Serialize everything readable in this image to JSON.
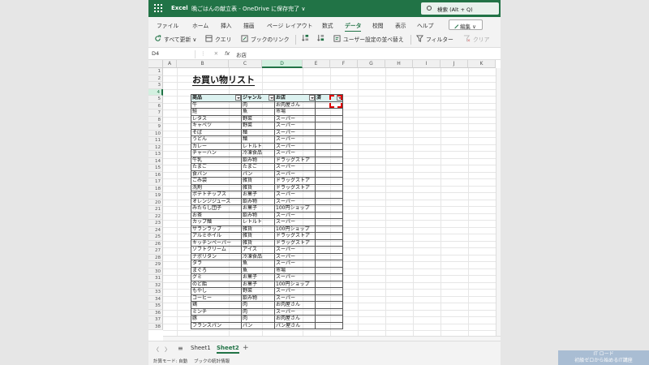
{
  "titlebar": {
    "app": "Excel",
    "doc": "晩ごはんの献立表 - OneDrive に保存完了 ∨",
    "search": "検索 (Alt + Q)"
  },
  "menu": {
    "items": [
      "ファイル",
      "ホーム",
      "挿入",
      "描画",
      "ページ レイアウト",
      "数式",
      "データ",
      "校閲",
      "表示",
      "ヘルプ"
    ],
    "active": "データ",
    "edit_label": "編集 ∨"
  },
  "ribbon": {
    "refresh_all": "すべて更新 ∨",
    "query": "クエリ",
    "links": "ブックのリンク",
    "sort_asc": "A↓Z",
    "sort_desc": "Z↓A",
    "custom_sort": "ユーザー設定の並べ替え",
    "filter": "フィルター",
    "clear": "クリア"
  },
  "formula_bar": {
    "name_box": "D4",
    "fx": "fx",
    "value": "お店"
  },
  "grid": {
    "columns": [
      "A",
      "B",
      "C",
      "D",
      "E",
      "F",
      "G",
      "H",
      "I",
      "J",
      "K"
    ],
    "selected_column": "D",
    "rows": [
      "1",
      "2",
      "3",
      "4",
      "5",
      "6",
      "7",
      "8",
      "9",
      "10",
      "11",
      "12",
      "13",
      "14",
      "15",
      "16",
      "17",
      "18",
      "19",
      "20",
      "21",
      "22",
      "23",
      "24",
      "25",
      "26",
      "27",
      "28",
      "29",
      "30",
      "31",
      "32",
      "33",
      "34",
      "35",
      "36",
      "37",
      "38"
    ],
    "selected_row": "4"
  },
  "list": {
    "title": "お買い物リスト",
    "headers": [
      "商品",
      "ジャンル",
      "お店",
      "済"
    ],
    "items": [
      [
        "牛",
        "肉",
        "お肉屋さん",
        ""
      ],
      [
        "鮭",
        "魚",
        "市場",
        ""
      ],
      [
        "レタス",
        "野菜",
        "スーパー",
        ""
      ],
      [
        "キャベツ",
        "野菜",
        "スーパー",
        ""
      ],
      [
        "そば",
        "麺",
        "スーパー",
        ""
      ],
      [
        "うどん",
        "麺",
        "スーパー",
        ""
      ],
      [
        "カレー",
        "レトルト",
        "スーパー",
        ""
      ],
      [
        "チャーハン",
        "冷凍食品",
        "スーパー",
        ""
      ],
      [
        "牛乳",
        "飲み物",
        "ドラッグストア",
        ""
      ],
      [
        "たまご",
        "たまご",
        "スーパー",
        ""
      ],
      [
        "食パン",
        "パン",
        "スーパー",
        ""
      ],
      [
        "ごみ袋",
        "雑貨",
        "ドラッグストア",
        ""
      ],
      [
        "洗剤",
        "雑貨",
        "ドラッグストア",
        ""
      ],
      [
        "ポテトチップス",
        "お菓子",
        "スーパー",
        ""
      ],
      [
        "オレンジジュース",
        "飲み物",
        "スーパー",
        ""
      ],
      [
        "みたらし団子",
        "お菓子",
        "100円ショップ",
        ""
      ],
      [
        "お茶",
        "飲み物",
        "スーパー",
        ""
      ],
      [
        "カップ麺",
        "レトルト",
        "スーパー",
        ""
      ],
      [
        "サランラップ",
        "雑貨",
        "100円ショップ",
        ""
      ],
      [
        "アルミホイル",
        "雑貨",
        "ドラッグストア",
        ""
      ],
      [
        "キッチンペーパー",
        "雑貨",
        "ドラッグストア",
        ""
      ],
      [
        "ソフトクリーム",
        "アイス",
        "スーパー",
        ""
      ],
      [
        "ナポリタン",
        "冷凍食品",
        "スーパー",
        ""
      ],
      [
        "タラ",
        "魚",
        "スーパー",
        ""
      ],
      [
        "まぐろ",
        "魚",
        "市場",
        ""
      ],
      [
        "グミ",
        "お菓子",
        "スーパー",
        ""
      ],
      [
        "のど飴",
        "お菓子",
        "100円ショップ",
        ""
      ],
      [
        "もやし",
        "野菜",
        "スーパー",
        ""
      ],
      [
        "コーヒー",
        "飲み物",
        "スーパー",
        ""
      ],
      [
        "鶏",
        "肉",
        "お肉屋さん",
        ""
      ],
      [
        "ミンチ",
        "肉",
        "スーパー",
        ""
      ],
      [
        "豚",
        "肉",
        "お肉屋さん",
        ""
      ],
      [
        "フランスパン",
        "パン",
        "パン屋さん",
        ""
      ]
    ]
  },
  "sheets": {
    "tabs": [
      "Sheet1",
      "Sheet2"
    ],
    "active": "Sheet2",
    "add": "+",
    "menu": "≡",
    "nav_prev": "〈",
    "nav_next": "〉"
  },
  "status": {
    "calc_mode": "計算モード: 自動",
    "workbook_stats": "ブックの統計情報"
  },
  "watermark": {
    "line1": "IT ロード",
    "line2": "初級ゼロから始めるIT講座"
  },
  "colors": {
    "brand": "#217346",
    "header_fill": "#dcf2f0",
    "highlight": "#e00000"
  }
}
